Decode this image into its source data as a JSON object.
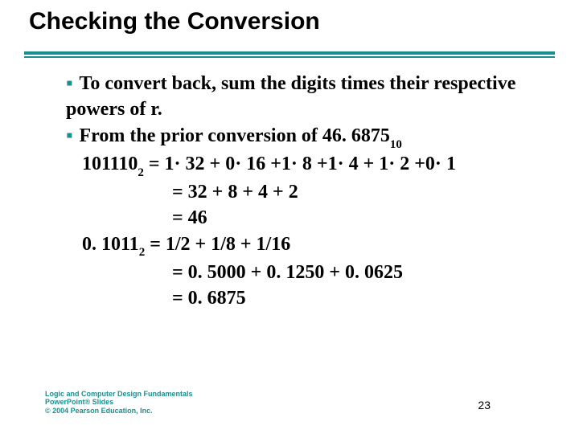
{
  "title": "Checking the Conversion",
  "bullets": {
    "first": "To convert back, sum the digits times their respective powers of r.",
    "second_prefix": "From the prior conversion of  46. 6875",
    "second_sub": "10"
  },
  "lines": {
    "l1_a": "101110",
    "l1_sub": "2",
    "l1_b": " = 1· 32 + 0· 16 +1· 8 +1· 4 + 1· 2 +0· 1",
    "l2": "=  32 + 8 + 4 + 2",
    "l3": "=  46",
    "l4_a": "0. 1011",
    "l4_sub": "2",
    "l4_b": " = 1/2 + 1/8 + 1/16",
    "l5": "= 0. 5000 + 0. 1250 + 0. 0625",
    "l6": "= 0. 6875"
  },
  "footer": {
    "logo1": "Logic and Computer Design Fundamentals",
    "logo2": "PowerPoint® Slides",
    "logo3": "© 2004 Pearson Education, Inc.",
    "page": "23"
  }
}
